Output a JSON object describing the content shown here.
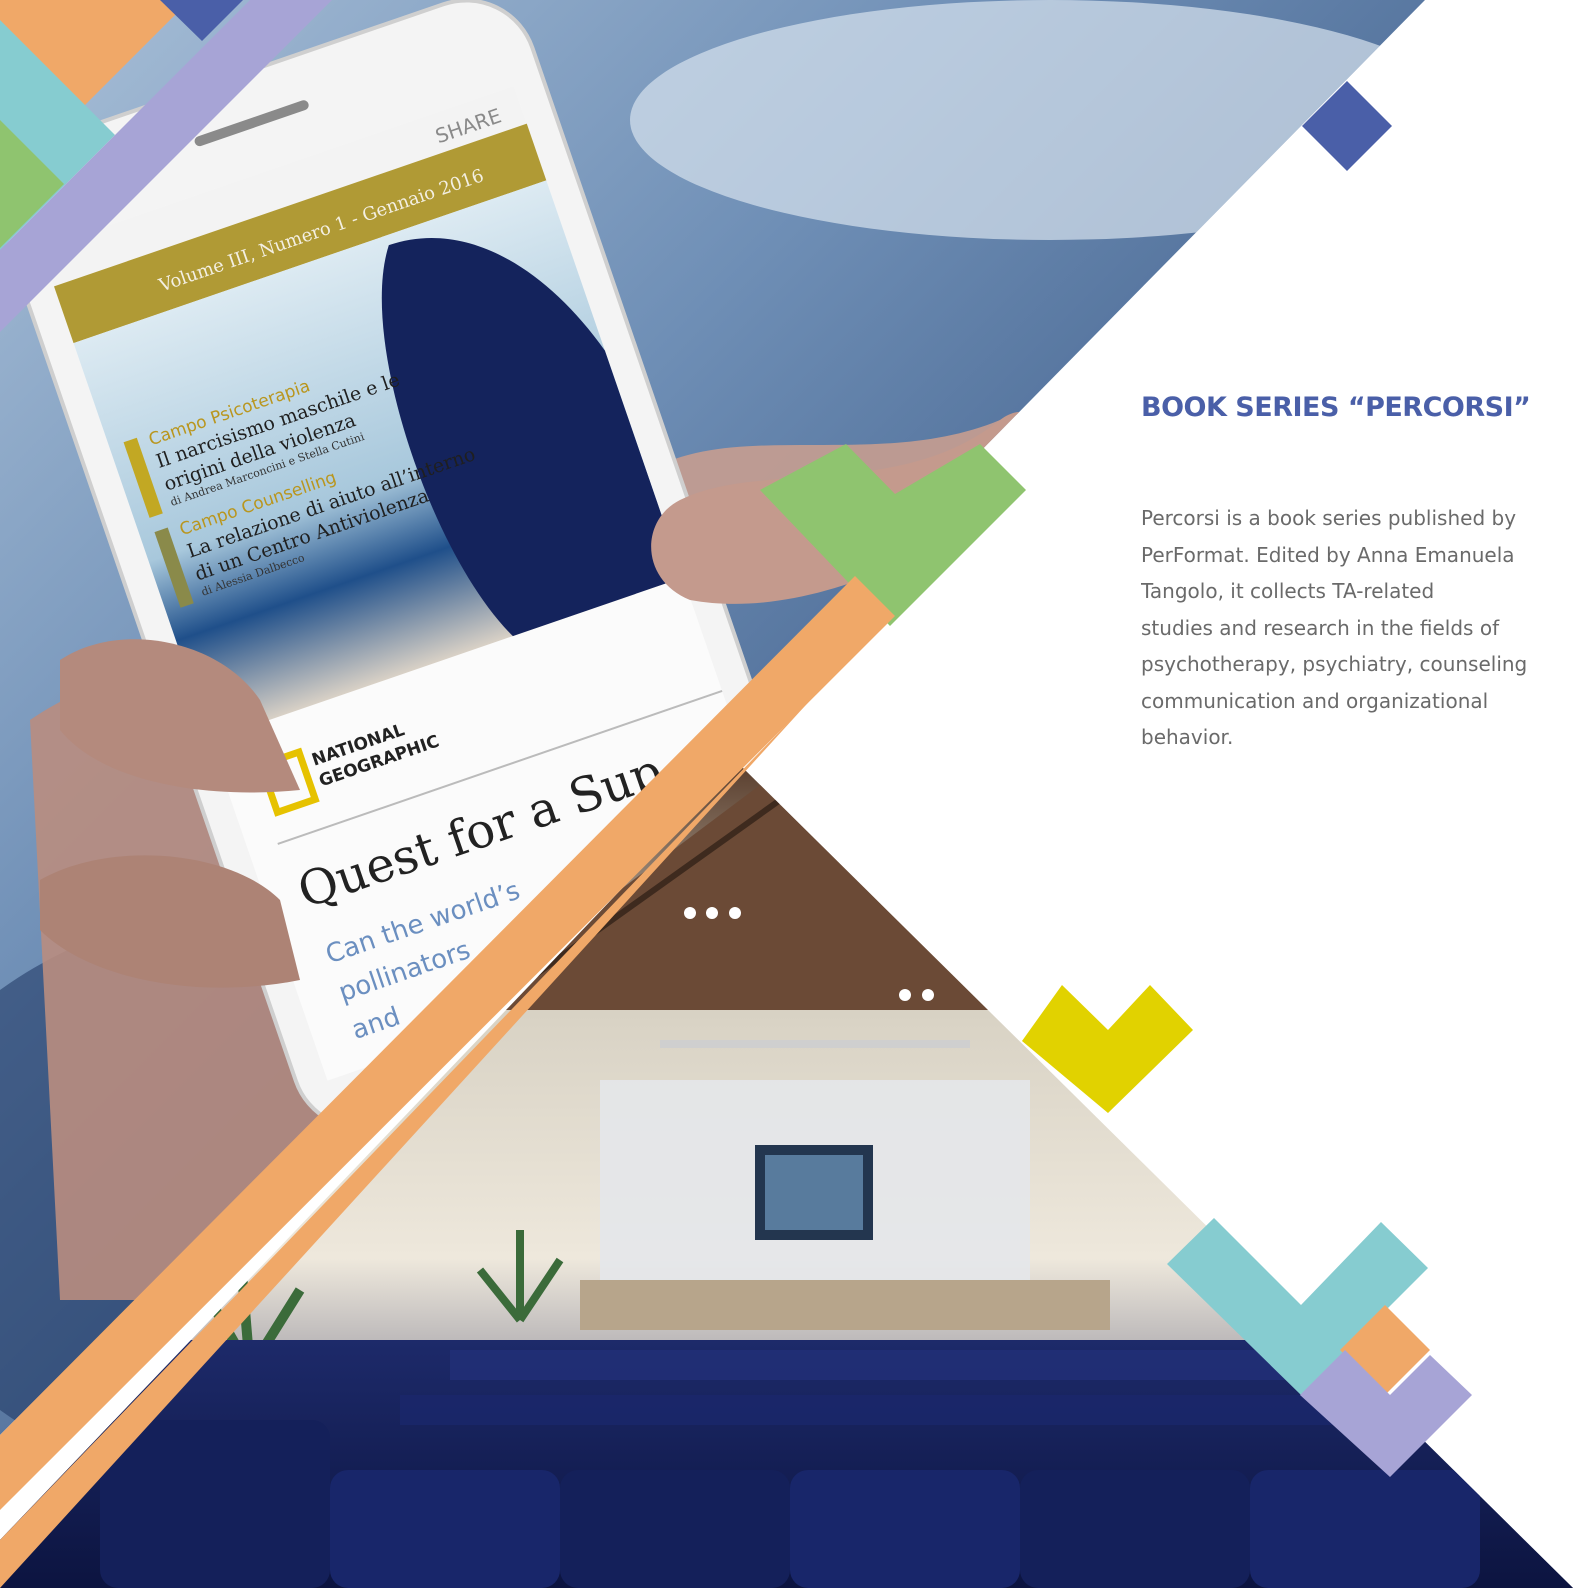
{
  "section": {
    "title": "BOOK SERIES “PERCORSI”",
    "description_lines": [
      "Percorsi is a book series published by",
      "PerFormat. Edited by Anna Emanuela",
      "Tangolo, it collects TA-related",
      "studies and research in the fields of",
      "psychotherapy, psychiatry, counseling",
      "communication and organizational",
      "behavior."
    ]
  },
  "phone": {
    "share_label": "SHARE",
    "issue_banner": "Volume III, Numero 1 - Gennaio 2016",
    "article1": {
      "category": "Campo Psicoterapia",
      "title_line1": "Il narcisismo maschile e le",
      "title_line2": "origini della violenza",
      "authors": "di Andrea Marconcini e Stella Cutini"
    },
    "article2": {
      "category": "Campo Counselling",
      "title_line1": "La relazione di aiuto all’interno",
      "title_line2": "di un Centro Antiviolenza",
      "authors": "di Alessia Dalbecco"
    },
    "logo_line1": "NATIONAL",
    "logo_line2": "GEOGRAPHIC",
    "headline": "Quest for a Sup",
    "subhead_line1": "Can the world’s",
    "subhead_line2": "pollinators",
    "subhead_line3": "and"
  },
  "colors": {
    "accent_blue": "#4a5fa8",
    "green": "#8fc46f",
    "orange": "#f0a868",
    "yellow": "#e1d200",
    "teal": "#86ccd0",
    "lavender": "#a7a4d6",
    "body_text": "#6a6a6a"
  }
}
